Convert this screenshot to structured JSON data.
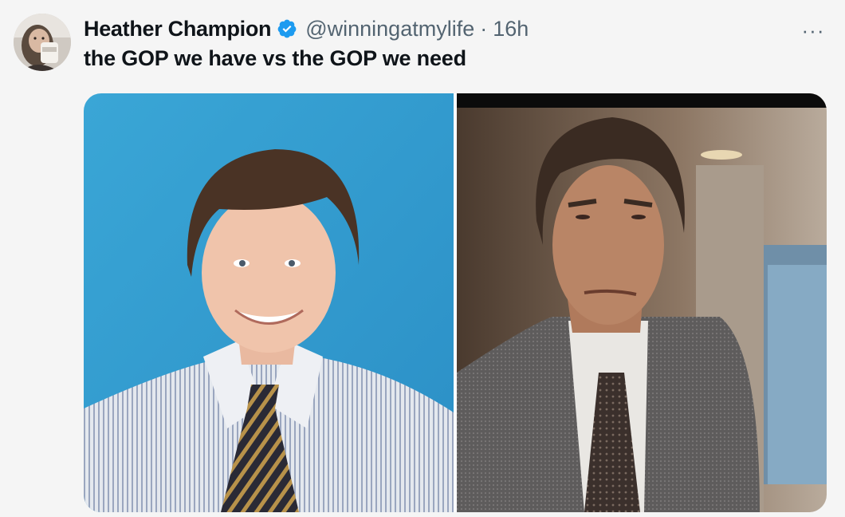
{
  "tweet": {
    "author": {
      "display_name": "Heather Champion",
      "handle": "@winningatmylife",
      "verified": true,
      "avatar_icon": "profile-avatar"
    },
    "separator": "·",
    "time": "16h",
    "more_label": "···",
    "text": "the GOP we have vs the GOP we need",
    "media": [
      {
        "icon": "photo"
      },
      {
        "icon": "photo"
      }
    ]
  },
  "colors": {
    "verified_badge": "#1d9bf0",
    "secondary_text": "#536471",
    "primary_text": "#0f1419"
  }
}
